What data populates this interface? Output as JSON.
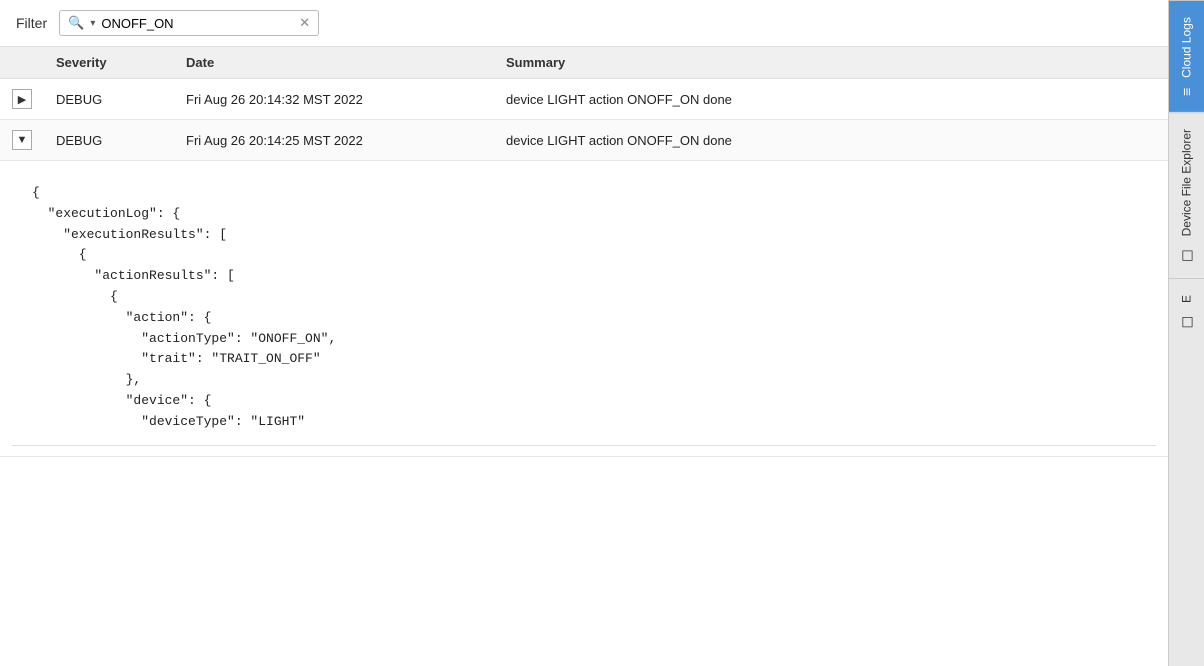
{
  "filter": {
    "label": "Filter",
    "value": "ONOFF_ON",
    "placeholder": "Filter",
    "search_icon": "🔍",
    "clear_icon": "✕",
    "dropdown_icon": "▾"
  },
  "table": {
    "columns": {
      "expand": "",
      "severity": "Severity",
      "date": "Date",
      "summary": "Summary"
    },
    "rows": [
      {
        "id": "row1",
        "expanded": false,
        "severity": "DEBUG",
        "date": "Fri Aug 26 20:14:32 MST 2022",
        "summary": "device LIGHT action ONOFF_ON done"
      },
      {
        "id": "row2",
        "expanded": true,
        "severity": "DEBUG",
        "date": "Fri Aug 26 20:14:25 MST 2022",
        "summary": "device LIGHT action ONOFF_ON done"
      }
    ],
    "json_content": "{\n  \"executionLog\": {\n    \"executionResults\": [\n      {\n        \"actionResults\": [\n          {\n            \"action\": {\n              \"actionType\": \"ONOFF_ON\",\n              \"trait\": \"TRAIT_ON_OFF\"\n            },\n            \"device\": {\n              \"deviceType\": \"LIGHT\""
  },
  "sidebar": {
    "tabs": [
      {
        "id": "cloud-logs",
        "label": "Cloud Logs",
        "icon": "≡",
        "active": true
      },
      {
        "id": "device-file-explorer",
        "label": "Device File Explorer",
        "icon": "□",
        "active": false
      },
      {
        "id": "other",
        "label": "E",
        "icon": "□",
        "active": false
      }
    ]
  }
}
